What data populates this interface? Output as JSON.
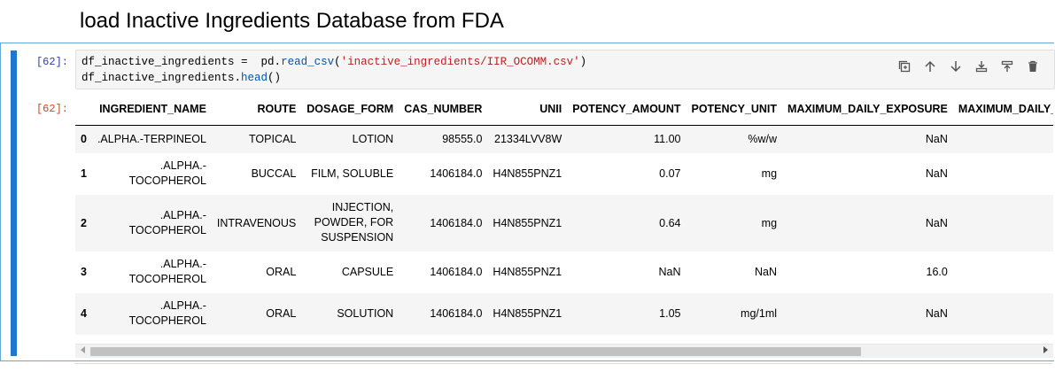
{
  "markdown": {
    "heading": "load Inactive Ingredients Database from FDA"
  },
  "cell": {
    "in_prompt": "[62]:",
    "out_prompt": "[62]:",
    "code": {
      "line1": {
        "var": "df_inactive_ingredients",
        "op": " =  ",
        "obj": "pd.",
        "call": "read_csv",
        "open": "(",
        "arg": "'inactive_ingredients/IIR_OCOMM.csv'",
        "close": ")"
      },
      "line2": {
        "var": "df_inactive_ingredients.",
        "call": "head",
        "rest": "()"
      }
    },
    "toolbar": [
      "duplicate-icon",
      "move-up-icon",
      "move-down-icon",
      "insert-below-icon",
      "insert-above-icon",
      "delete-icon"
    ]
  },
  "table": {
    "columns": [
      "",
      "INGREDIENT_NAME",
      "ROUTE",
      "DOSAGE_FORM",
      "CAS_NUMBER",
      "UNII",
      "POTENCY_AMOUNT",
      "POTENCY_UNIT",
      "MAXIMUM_DAILY_EXPOSURE",
      "MAXIMUM_DAILY_EXPOSURE_UNIT"
    ],
    "rows": [
      [
        "0",
        ".ALPHA.-TERPINEOL",
        "TOPICAL",
        "LOTION",
        "98555.0",
        "21334LVV8W",
        "11.00",
        "%w/w",
        "NaN",
        ""
      ],
      [
        "1",
        ".ALPHA.-TOCOPHEROL",
        "BUCCAL",
        "FILM, SOLUBLE",
        "1406184.0",
        "H4N855PNZ1",
        "0.07",
        "mg",
        "NaN",
        ""
      ],
      [
        "2",
        ".ALPHA.-TOCOPHEROL",
        "INTRAVENOUS",
        "INJECTION, POWDER, FOR SUSPENSION",
        "1406184.0",
        "H4N855PNZ1",
        "0.64",
        "mg",
        "NaN",
        ""
      ],
      [
        "3",
        ".ALPHA.-TOCOPHEROL",
        "ORAL",
        "CAPSULE",
        "1406184.0",
        "H4N855PNZ1",
        "NaN",
        "NaN",
        "16.0",
        ""
      ],
      [
        "4",
        ".ALPHA.-TOCOPHEROL",
        "ORAL",
        "SOLUTION",
        "1406184.0",
        "H4N855PNZ1",
        "1.05",
        "mg/1ml",
        "NaN",
        ""
      ]
    ]
  },
  "colors": {
    "accent": "#1f77d0",
    "in_prompt": "#303f9f",
    "out_prompt": "#d84315",
    "string": "#ba2121"
  }
}
